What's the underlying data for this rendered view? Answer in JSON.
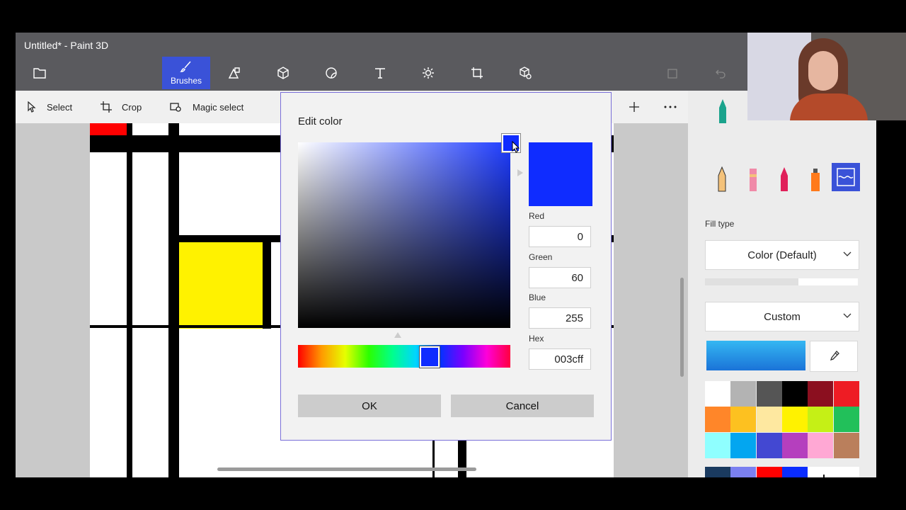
{
  "window": {
    "title": "Untitled* - Paint 3D"
  },
  "ribbon": {
    "active_label": "Brushes"
  },
  "cmdbar": {
    "select": "Select",
    "crop": "Crop",
    "magic_select": "Magic select"
  },
  "dialog": {
    "title": "Edit color",
    "preview_color": "#0f2cff",
    "red_label": "Red",
    "red_value": "0",
    "green_label": "Green",
    "green_value": "60",
    "blue_label": "Blue",
    "blue_value": "255",
    "hex_label": "Hex",
    "hex_value": "003cff",
    "ok": "OK",
    "cancel": "Cancel"
  },
  "sidebar": {
    "fill_type_label": "Fill type",
    "fill_type_value": "Color (Default)",
    "custom_value": "Custom",
    "palette": [
      "#ffffff",
      "#b3b3b3",
      "#555555",
      "#000000",
      "#8b0f1f",
      "#ee1c24",
      "#ff8629",
      "#fdc120",
      "#fee8a0",
      "#fff200",
      "#c5f016",
      "#22c05a",
      "#8fffff",
      "#03a6f0",
      "#4348d2",
      "#b53fbe",
      "#ffa8d4",
      "#ba7f5c"
    ],
    "custom_colors": [
      "#1a3a5f",
      "#7b80f0",
      "#ff0000",
      "#0a2cff"
    ]
  }
}
